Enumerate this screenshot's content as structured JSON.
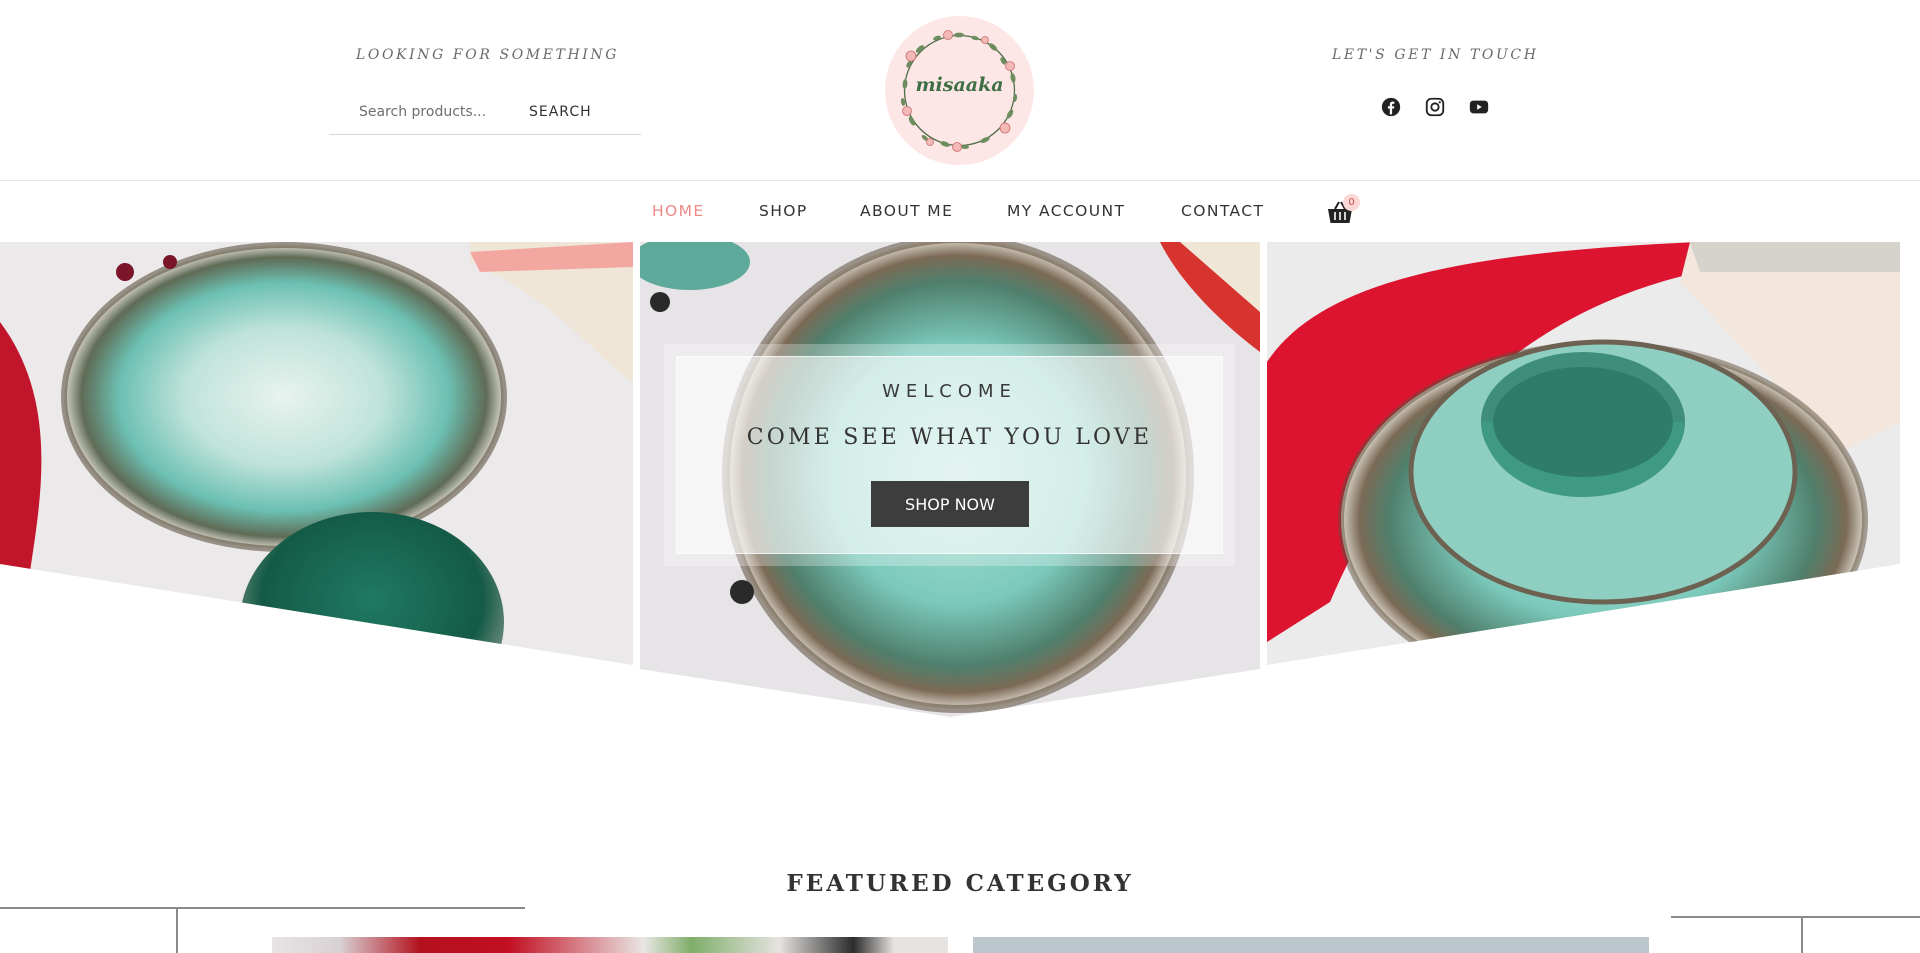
{
  "header": {
    "left_tagline": "LOOKING FOR SOMETHING",
    "right_tagline": "LET'S GET IN TOUCH",
    "search": {
      "placeholder": "Search products...",
      "button_label": "SEARCH"
    },
    "logo_text": "misaaka",
    "socials": [
      {
        "name": "facebook",
        "icon": "facebook-icon"
      },
      {
        "name": "instagram",
        "icon": "instagram-icon"
      },
      {
        "name": "youtube",
        "icon": "youtube-icon"
      }
    ]
  },
  "nav": {
    "items": [
      {
        "label": "HOME",
        "active": true
      },
      {
        "label": "SHOP",
        "active": false
      },
      {
        "label": "ABOUT ME",
        "active": false
      },
      {
        "label": "MY ACCOUNT",
        "active": false
      },
      {
        "label": "CONTACT",
        "active": false
      }
    ],
    "cart_count": "0"
  },
  "hero": {
    "eyebrow": "WELCOME",
    "title": "COME SEE WHAT YOU LOVE",
    "button_label": "SHOP NOW"
  },
  "featured": {
    "title": "FEATURED CATEGORY"
  },
  "colors": {
    "accent": "#ee8a88",
    "logo_bg": "#fde6e6",
    "button_bg": "#3c3d3c",
    "text": "#333333"
  }
}
